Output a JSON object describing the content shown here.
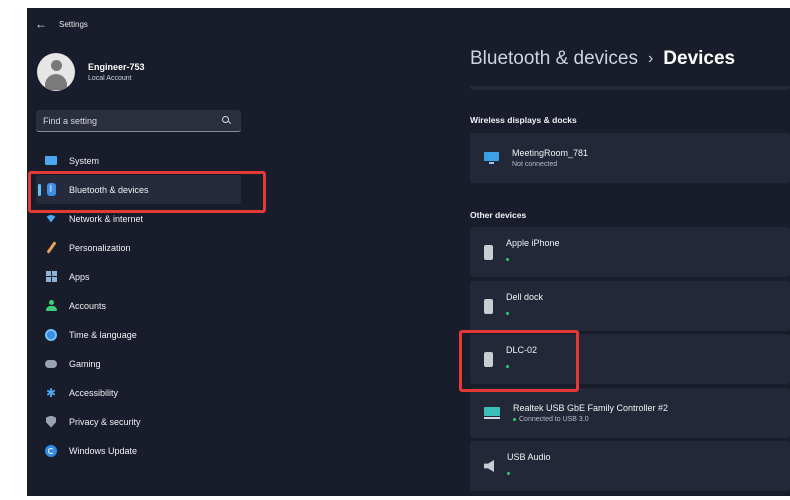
{
  "window": {
    "title": "Settings",
    "back_glyph": "←"
  },
  "profile": {
    "name": "Engineer-753",
    "account_type": "Local Account"
  },
  "search": {
    "placeholder": "Find a setting",
    "icon": "search-icon"
  },
  "sidebar": {
    "items": [
      {
        "label": "System",
        "icon": "system-icon",
        "active": false
      },
      {
        "label": "Bluetooth & devices",
        "icon": "bluetooth-icon",
        "active": true
      },
      {
        "label": "Network & internet",
        "icon": "network-icon",
        "active": false
      },
      {
        "label": "Personalization",
        "icon": "personalization-icon",
        "active": false
      },
      {
        "label": "Apps",
        "icon": "apps-icon",
        "active": false
      },
      {
        "label": "Accounts",
        "icon": "accounts-icon",
        "active": false
      },
      {
        "label": "Time & language",
        "icon": "time-language-icon",
        "active": false
      },
      {
        "label": "Gaming",
        "icon": "gaming-icon",
        "active": false
      },
      {
        "label": "Accessibility",
        "icon": "accessibility-icon",
        "active": false
      },
      {
        "label": "Privacy & security",
        "icon": "privacy-icon",
        "active": false
      },
      {
        "label": "Windows Update",
        "icon": "windows-update-icon",
        "active": false
      }
    ]
  },
  "breadcrumb": {
    "parent": "Bluetooth & devices",
    "separator": "›",
    "current": "Devices"
  },
  "sections": {
    "wireless": {
      "title": "Wireless displays & docks",
      "devices": [
        {
          "name": "MeetingRoom_781",
          "status": "Not connected",
          "icon": "monitor-icon"
        }
      ]
    },
    "other": {
      "title": "Other devices",
      "devices": [
        {
          "name": "Apple iPhone",
          "status": "",
          "icon": "phone-icon",
          "connected": true
        },
        {
          "name": "Dell dock",
          "status": "",
          "icon": "phone-icon",
          "connected": true
        },
        {
          "name": "DLC-02",
          "status": "",
          "icon": "phone-icon",
          "connected": true
        },
        {
          "name": "Realtek USB GbE Family Controller #2",
          "status": "Connected to USB 3.0",
          "icon": "network-adapter-icon",
          "connected": true
        },
        {
          "name": "USB Audio",
          "status": "",
          "icon": "speaker-icon",
          "connected": true
        }
      ]
    }
  },
  "colors": {
    "background": "#181c2b",
    "card": "#232838",
    "accent": "#5ec2f2",
    "highlight": "#e53935",
    "status_dot": "#2ecc71"
  }
}
